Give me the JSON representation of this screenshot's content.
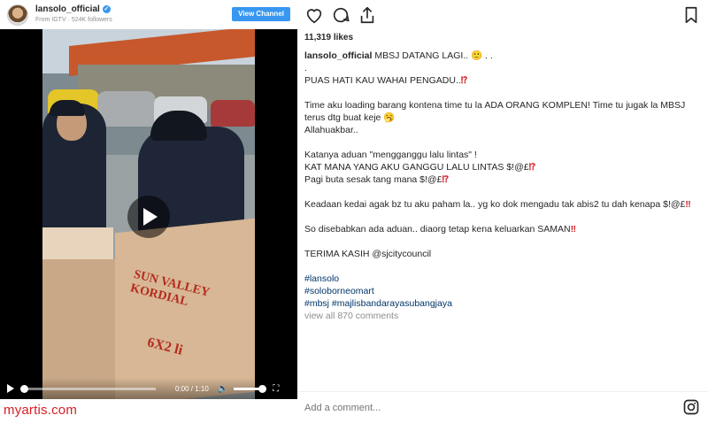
{
  "header": {
    "username": "lansolo_official",
    "subtitle": "From IGTV · 524K followers",
    "view_channel": "View Channel"
  },
  "video": {
    "box_text_1": "SUN VALLEY",
    "box_text_2": "KORDIAL",
    "box_text_3": "6X2 li",
    "time": "0:00 / 1:10",
    "progress": 0,
    "volume": 1
  },
  "watermark": "myartis.com",
  "likes": "11,319 likes",
  "caption": {
    "username": "lansolo_official",
    "first_line": "MBSJ DATANG LAGI.. 🙂 . .",
    "lines": [
      ".",
      "PUAS HATI KAU WAHAI PENGADU..",
      "",
      "Time aku loading barang kontena time tu la ADA ORANG KOMPLEN! Time tu jugak la MBSJ terus dtg buat keje 🥱",
      "Allahuakbar..",
      "",
      "Katanya aduan \"mengganggu lalu lintas\" !",
      "KAT MANA YANG AKU GANGGU LALU LINTAS $!@£",
      "Pagi buta sesak tang mana $!@£",
      "",
      "Keadaan kedai agak bz tu aku paham la.. yg ko dok mengadu tak abis2 tu dah kenapa $!@£",
      "",
      "So disebabkan ada aduan.. diaorg tetap kena keluarkan SAMAN",
      "",
      "TERIMA KASIH @sjcitycouncil",
      ""
    ],
    "emphasis": {
      "interrobang": "⁉",
      "double_bang": "‼"
    },
    "hashtags": [
      "#lansolo",
      "#soloborneomart",
      "#mbsj #majlisbandarayasubangjaya"
    ],
    "view_all": "view all 870 comments"
  },
  "comment": {
    "placeholder": "Add a comment..."
  },
  "colors": {
    "accent": "#3897f0",
    "watermark": "#d51e24",
    "emphasis": "#d51e24"
  },
  "icons": [
    "heart-icon",
    "comment-icon",
    "share-icon",
    "bookmark-icon",
    "play-icon",
    "volume-icon",
    "fullscreen-icon",
    "instagram-icon",
    "verified-icon"
  ]
}
